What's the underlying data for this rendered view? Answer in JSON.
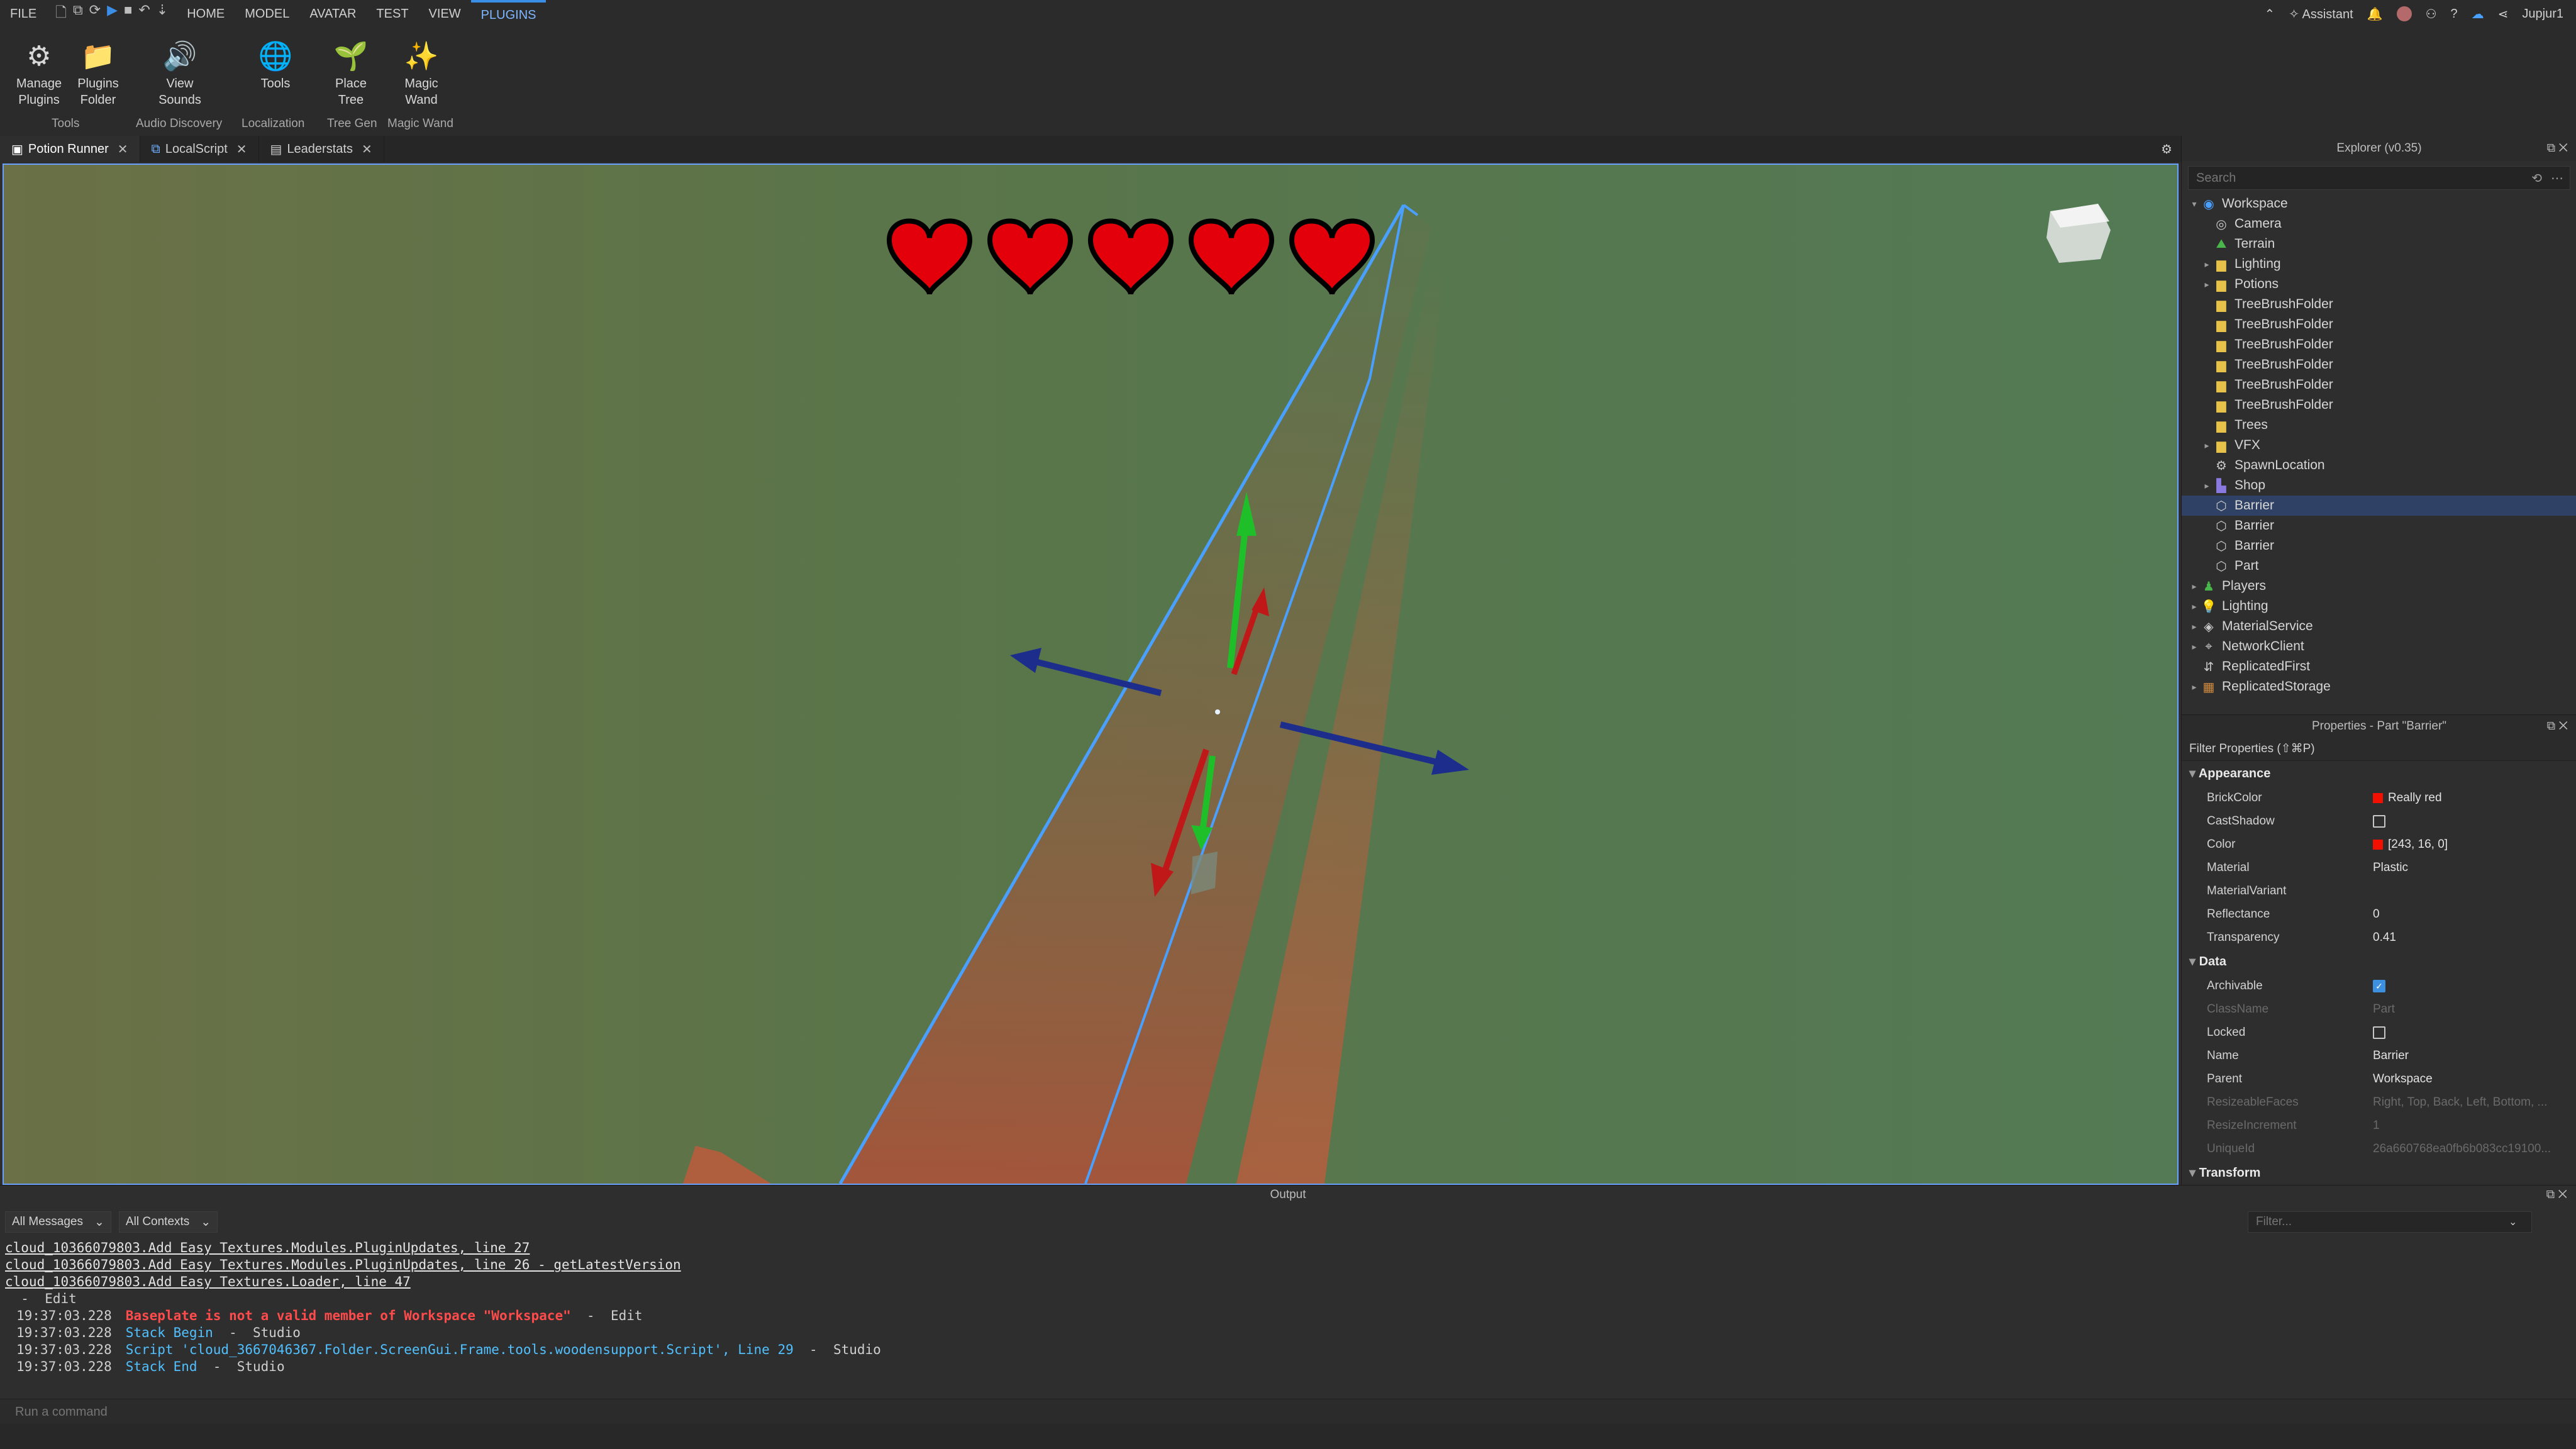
{
  "menu": {
    "file": "FILE",
    "tabs": [
      "HOME",
      "MODEL",
      "AVATAR",
      "TEST",
      "VIEW",
      "PLUGINS"
    ],
    "active_tab": "PLUGINS",
    "assistant": "Assistant",
    "username": "Jupjur1"
  },
  "ribbon": {
    "tools": [
      {
        "label1": "Manage",
        "label2": "Plugins",
        "icon": "gear-plug-icon"
      },
      {
        "label1": "Plugins",
        "label2": "Folder",
        "icon": "folder-icon"
      },
      {
        "label1": "View",
        "label2": "Sounds",
        "icon": "speaker-icon"
      },
      {
        "label1": "Tools",
        "label2": "",
        "icon": "globe-icon"
      },
      {
        "label1": "Place",
        "label2": "Tree",
        "icon": "tree-icon"
      },
      {
        "label1": "Magic",
        "label2": "Wand",
        "icon": "wand-icon"
      }
    ],
    "groups": [
      "Tools",
      "Audio Discovery",
      "Localization",
      "Tree Gen",
      "Magic Wand"
    ]
  },
  "doc_tabs": [
    {
      "label": "Potion Runner",
      "icon": "place-icon"
    },
    {
      "label": "LocalScript",
      "icon": "script-icon"
    },
    {
      "label": "Leaderstats",
      "icon": "script-icon"
    }
  ],
  "viewport": {
    "hearts": 5,
    "accent_colors": {
      "gizmo_green": "#1fbf2a",
      "gizmo_red": "#c01818",
      "gizmo_blue": "#1c2d8c",
      "selection": "#4aa0ff",
      "barrier": "#c45a3c"
    }
  },
  "explorer": {
    "title": "Explorer (v0.35)",
    "search_placeholder": "Search",
    "items": [
      {
        "label": "Workspace",
        "depth": 0,
        "arrow": "▾",
        "icon": "workspace-icon",
        "sel": false
      },
      {
        "label": "Camera",
        "depth": 1,
        "arrow": "",
        "icon": "camera-icon",
        "sel": false
      },
      {
        "label": "Terrain",
        "depth": 1,
        "arrow": "",
        "icon": "terrain-icon",
        "sel": false
      },
      {
        "label": "Lighting",
        "depth": 1,
        "arrow": "▸",
        "icon": "folder-icon",
        "sel": false
      },
      {
        "label": "Potions",
        "depth": 1,
        "arrow": "▸",
        "icon": "folder-icon",
        "sel": false
      },
      {
        "label": "TreeBrushFolder",
        "depth": 1,
        "arrow": "",
        "icon": "folder-icon",
        "sel": false
      },
      {
        "label": "TreeBrushFolder",
        "depth": 1,
        "arrow": "",
        "icon": "folder-icon",
        "sel": false
      },
      {
        "label": "TreeBrushFolder",
        "depth": 1,
        "arrow": "",
        "icon": "folder-icon",
        "sel": false
      },
      {
        "label": "TreeBrushFolder",
        "depth": 1,
        "arrow": "",
        "icon": "folder-icon",
        "sel": false
      },
      {
        "label": "TreeBrushFolder",
        "depth": 1,
        "arrow": "",
        "icon": "folder-icon",
        "sel": false
      },
      {
        "label": "TreeBrushFolder",
        "depth": 1,
        "arrow": "",
        "icon": "folder-icon",
        "sel": false
      },
      {
        "label": "Trees",
        "depth": 1,
        "arrow": "",
        "icon": "folder-icon",
        "sel": false
      },
      {
        "label": "VFX",
        "depth": 1,
        "arrow": "▸",
        "icon": "folder-icon",
        "sel": false
      },
      {
        "label": "SpawnLocation",
        "depth": 1,
        "arrow": "",
        "icon": "spawn-icon",
        "sel": false
      },
      {
        "label": "Shop",
        "depth": 1,
        "arrow": "▸",
        "icon": "model-icon",
        "sel": false
      },
      {
        "label": "Barrier",
        "depth": 1,
        "arrow": "",
        "icon": "part-icon",
        "sel": true
      },
      {
        "label": "Barrier",
        "depth": 1,
        "arrow": "",
        "icon": "part-icon",
        "sel": false
      },
      {
        "label": "Barrier",
        "depth": 1,
        "arrow": "",
        "icon": "part-icon",
        "sel": false
      },
      {
        "label": "Part",
        "depth": 1,
        "arrow": "",
        "icon": "part-icon",
        "sel": false
      },
      {
        "label": "Players",
        "depth": 0,
        "arrow": "▸",
        "icon": "players-icon",
        "sel": false
      },
      {
        "label": "Lighting",
        "depth": 0,
        "arrow": "▸",
        "icon": "lightbulb-icon",
        "sel": false
      },
      {
        "label": "MaterialService",
        "depth": 0,
        "arrow": "▸",
        "icon": "material-icon",
        "sel": false
      },
      {
        "label": "NetworkClient",
        "depth": 0,
        "arrow": "▸",
        "icon": "network-icon",
        "sel": false
      },
      {
        "label": "ReplicatedFirst",
        "depth": 0,
        "arrow": "",
        "icon": "replicated-icon",
        "sel": false
      },
      {
        "label": "ReplicatedStorage",
        "depth": 0,
        "arrow": "▸",
        "icon": "storage-icon",
        "sel": false
      }
    ]
  },
  "properties": {
    "title": "Properties - Part \"Barrier\"",
    "filter": "Filter Properties (⇧⌘P)",
    "sections": [
      {
        "name": "Appearance",
        "rows": [
          {
            "k": "BrickColor",
            "v": "Really red",
            "type": "swatch",
            "dim": false
          },
          {
            "k": "CastShadow",
            "v": "",
            "type": "check",
            "on": false,
            "dim": false
          },
          {
            "k": "Color",
            "v": "[243, 16, 0]",
            "type": "swatch",
            "dim": false
          },
          {
            "k": "Material",
            "v": "Plastic",
            "type": "text",
            "dim": false
          },
          {
            "k": "MaterialVariant",
            "v": "",
            "type": "text",
            "dim": false
          },
          {
            "k": "Reflectance",
            "v": "0",
            "type": "text",
            "dim": false
          },
          {
            "k": "Transparency",
            "v": "0.41",
            "type": "text",
            "dim": false
          }
        ]
      },
      {
        "name": "Data",
        "rows": [
          {
            "k": "Archivable",
            "v": "",
            "type": "check",
            "on": true,
            "dim": false
          },
          {
            "k": "ClassName",
            "v": "Part",
            "type": "text",
            "dim": true
          },
          {
            "k": "Locked",
            "v": "",
            "type": "check",
            "on": false,
            "dim": false
          },
          {
            "k": "Name",
            "v": "Barrier",
            "type": "text",
            "dim": false
          },
          {
            "k": "Parent",
            "v": "Workspace",
            "type": "text",
            "dim": false
          },
          {
            "k": "ResizeableFaces",
            "v": "Right, Top, Back, Left, Bottom, ...",
            "type": "text",
            "dim": true
          },
          {
            "k": "ResizeIncrement",
            "v": "1",
            "type": "text",
            "dim": true
          },
          {
            "k": "UniqueId",
            "v": "26a660768ea0fb6b083cc19100...",
            "type": "text",
            "dim": true
          }
        ]
      },
      {
        "name": "Transform",
        "rows": []
      }
    ]
  },
  "output": {
    "title": "Output",
    "filter1": "All Messages",
    "filter2": "All Contexts",
    "filter_placeholder": "Filter...",
    "lines": [
      {
        "ts": "",
        "parts": [
          {
            "t": "cloud_10366079803.Add Easy Textures.Modules.PluginUpdates, line 27",
            "c": "link"
          }
        ]
      },
      {
        "ts": "",
        "parts": [
          {
            "t": "cloud_10366079803.Add Easy Textures.Modules.PluginUpdates, line 26 - getLatestVersion",
            "c": "link"
          }
        ]
      },
      {
        "ts": "",
        "parts": [
          {
            "t": "cloud_10366079803.Add Easy Textures.Loader, line 47",
            "c": "link"
          }
        ]
      },
      {
        "ts": "",
        "parts": [
          {
            "t": "  -  Edit",
            "c": ""
          }
        ]
      },
      {
        "ts": "19:37:03.228",
        "parts": [
          {
            "t": "Baseplate is not a valid member of Workspace \"Workspace\"",
            "c": "red"
          },
          {
            "t": "  -  Edit",
            "c": ""
          }
        ]
      },
      {
        "ts": "19:37:03.228",
        "parts": [
          {
            "t": "Stack Begin",
            "c": "blue"
          },
          {
            "t": "  -  Studio",
            "c": ""
          }
        ]
      },
      {
        "ts": "19:37:03.228",
        "parts": [
          {
            "t": "Script 'cloud_3667046367.Folder.ScreenGui.Frame.tools.woodensupport.Script', Line 29",
            "c": "blue"
          },
          {
            "t": "  -  Studio",
            "c": ""
          }
        ]
      },
      {
        "ts": "19:37:03.228",
        "parts": [
          {
            "t": "Stack End",
            "c": "blue"
          },
          {
            "t": "  -  Studio",
            "c": ""
          }
        ]
      }
    ]
  },
  "command_bar": {
    "placeholder": "Run a command"
  }
}
